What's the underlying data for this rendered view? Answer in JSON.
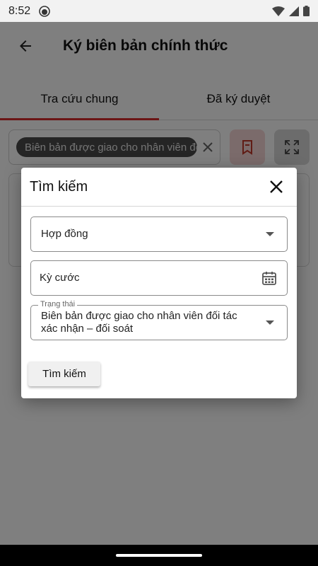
{
  "status_bar": {
    "time": "8:52"
  },
  "app_bar": {
    "title": "Ký biên bản chính thức"
  },
  "tabs": [
    {
      "label": "Tra cứu chung",
      "active": true
    },
    {
      "label": "Đã ký duyệt",
      "active": false
    }
  ],
  "search": {
    "chip_text": "Biên bản được giao cho nhân viên đối tác xác nhận – đối soát"
  },
  "dialog": {
    "title": "Tìm kiếm",
    "contract_field": {
      "value": "Hợp đồng"
    },
    "period_field": {
      "value": "Kỳ cước"
    },
    "status_field": {
      "label": "Trạng thái",
      "value": "Biên bản được giao cho nhân viên đối tác xác nhận – đối soát"
    },
    "search_button": "Tìm kiếm"
  },
  "colors": {
    "accent": "#d62a2a",
    "scrim": "rgba(0,0,0,0.5)"
  }
}
